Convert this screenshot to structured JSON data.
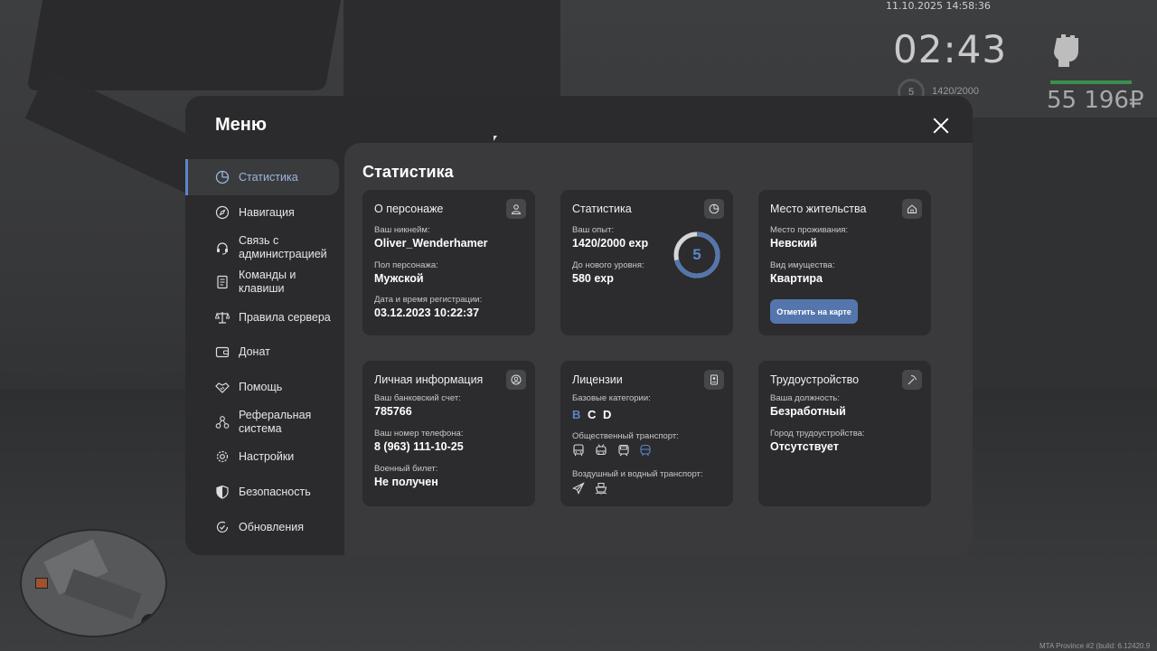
{
  "hud": {
    "datetime": "11.10.2025 14:58:36",
    "clock": "02:43",
    "level": "5",
    "exp": "1420/2000",
    "money": "55 196₽",
    "build": "MTA Province #2 (build: 6.12420.9",
    "minimap_north": "N"
  },
  "menu": {
    "title": "Меню",
    "sidebar": [
      {
        "label": "Статистика",
        "icon": "pie-chart-icon",
        "active": true
      },
      {
        "label": "Навигация",
        "icon": "compass-icon"
      },
      {
        "label": "Связь с администрацией",
        "icon": "headset-icon"
      },
      {
        "label": "Команды и клавиши",
        "icon": "document-icon"
      },
      {
        "label": "Правила сервера",
        "icon": "scales-icon"
      },
      {
        "label": "Донат",
        "icon": "wallet-icon"
      },
      {
        "label": "Помощь",
        "icon": "handshake-icon"
      },
      {
        "label": "Реферальная система",
        "icon": "network-icon"
      },
      {
        "label": "Настройки",
        "icon": "gear-icon"
      },
      {
        "label": "Безопасность",
        "icon": "shield-icon"
      },
      {
        "label": "Обновления",
        "icon": "refresh-check-icon"
      }
    ],
    "content_title": "Статистика",
    "cards": {
      "character": {
        "title": "О персонаже",
        "nickname_label": "Ваш никнейм:",
        "nickname": "Oliver_Wenderhamer",
        "gender_label": "Пол персонажа:",
        "gender": "Мужской",
        "reg_label": "Дата и время регистрации:",
        "reg": "03.12.2023 10:22:37"
      },
      "stats": {
        "title": "Статистика",
        "exp_label": "Ваш опыт:",
        "exp": "1420/2000 exp",
        "next_label": "До нового уровня:",
        "next": "580 exp",
        "level": "5",
        "progress": 0.71
      },
      "residence": {
        "title": "Место жительства",
        "place_label": "Место проживания:",
        "place": "Невский",
        "type_label": "Вид имущества:",
        "type": "Квартира",
        "button": "Отметить на карте"
      },
      "personal": {
        "title": "Личная информация",
        "bank_label": "Ваш банковский счет:",
        "bank": "785766",
        "phone_label": "Ваш номер телефона:",
        "phone": "8 (963) 111-10-25",
        "military_label": "Военный билет:",
        "military": "Не получен"
      },
      "licenses": {
        "title": "Лицензии",
        "basic_label": "Базовые категории:",
        "categories": [
          {
            "letter": "B",
            "color": "#5d86c6"
          },
          {
            "letter": "C",
            "color": "#ffffff"
          },
          {
            "letter": "D",
            "color": "#ffffff"
          }
        ],
        "public_label": "Общественный транспорт:",
        "air_label": "Воздушный и водный транспорт:"
      },
      "employment": {
        "title": "Трудоустройство",
        "position_label": "Ваша должность:",
        "position": "Безработный",
        "city_label": "Город трудоустройства:",
        "city": "Отсутствует"
      }
    }
  },
  "colors": {
    "accent": "#5d86c6",
    "button": "#5476ad",
    "panel": "#2b2b2d",
    "card": "#2c2c2e"
  }
}
